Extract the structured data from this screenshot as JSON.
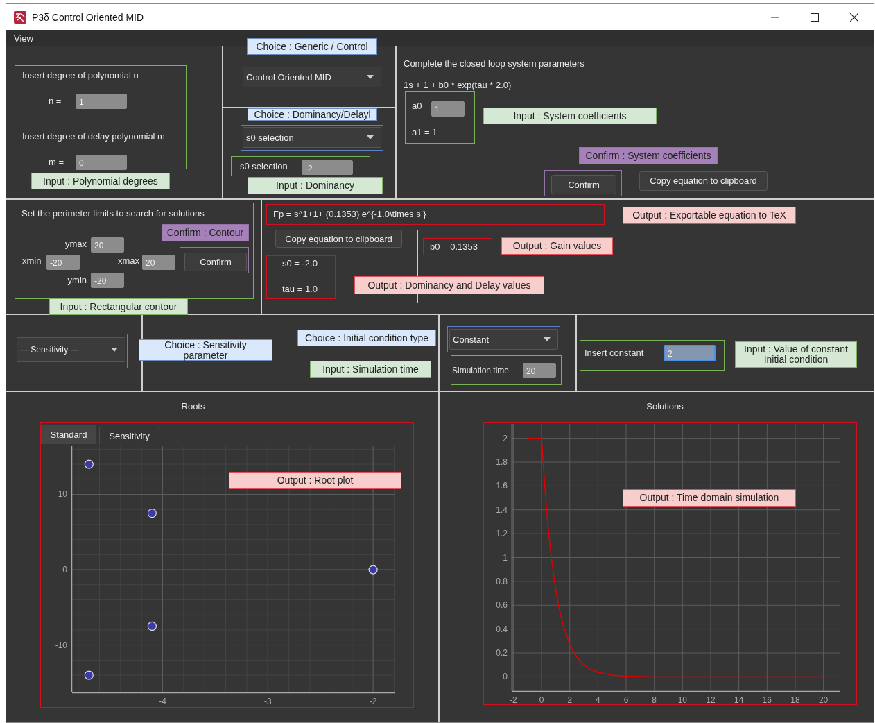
{
  "window": {
    "title": "P3δ Control Oriented MID"
  },
  "menu": [
    {
      "label": "View"
    }
  ],
  "polynomial_degrees": {
    "n_prompt": "Insert degree of polynomial n",
    "n_label": "n =",
    "n_field": {
      "value": "1",
      "focused": false
    },
    "m_prompt": "Insert degree of delay polynomial m",
    "m_label": "m =",
    "m_field": {
      "value": "0",
      "focused": false
    },
    "notes": [
      {
        "kind": "input",
        "text": "Input : Polynomial degrees"
      }
    ]
  },
  "mode": {
    "notes": [
      {
        "kind": "choice",
        "text": "Choice : Generic / Control"
      }
    ],
    "dropdown": "Control Oriented MID"
  },
  "dominancy": {
    "notes": [
      {
        "kind": "choice",
        "text": "Choice : Dominancy/Delayl"
      },
      {
        "kind": "input",
        "text": "Input : Dominancy"
      }
    ],
    "dropdown": "s0 selection",
    "s0_label": "s0 selection",
    "s0_field": {
      "value": "-2",
      "focused": false
    }
  },
  "system": {
    "heading": "Complete the closed loop system parameters",
    "equation": "1s + 1 + b0 * exp(tau * 2.0)",
    "a0_label": "a0",
    "a0_field": {
      "value": "1",
      "focused": false
    },
    "a1": "a1 = 1",
    "notes": [
      {
        "kind": "input",
        "text": "Input : System coefficients"
      },
      {
        "kind": "confirm",
        "text": "Confirm : System coefficients"
      }
    ],
    "confirm_button": "Confirm",
    "copy_button": "Copy equation to clipboard"
  },
  "contour": {
    "heading": "Set the perimeter limits to search for solutions",
    "fields": [
      {
        "label": "ymax",
        "value": "20",
        "focused": false
      },
      {
        "label": "xmin",
        "value": "-20",
        "focused": false
      },
      {
        "label": "xmax",
        "value": "20",
        "focused": false
      },
      {
        "label": "ymin",
        "value": "-20",
        "focused": false
      }
    ],
    "confirm_button": "Confirm",
    "notes": [
      {
        "kind": "confirm",
        "text": "Confirm : Contour"
      },
      {
        "kind": "input",
        "text": "Input : Rectangular contour"
      }
    ]
  },
  "output": {
    "equation": "Fp = s^1+1+ (0.1353) e^{-1.0\\times s }",
    "copy_button": "Copy equation to clipboard",
    "s0": "s0 = -2.0",
    "tau": "tau = 1.0",
    "b0": "b0 = 0.1353",
    "notes": [
      {
        "kind": "output",
        "text": "Output : Exportable equation to TeX"
      },
      {
        "kind": "output",
        "text": "Output : Gain values"
      },
      {
        "kind": "output",
        "text": "Output : Dominancy and Delay values"
      }
    ]
  },
  "simulation": {
    "sensitivity_dropdown": "--- Sensitivity ---",
    "initial_condition_dropdown": "Constant",
    "time_label": "Simulation time",
    "time_field": {
      "value": "20",
      "focused": false
    },
    "constant_label": "Insert constant",
    "constant_field": {
      "value": "2",
      "focused": true
    },
    "notes": [
      {
        "kind": "choice",
        "text": "Choice : Sensitivity parameter"
      },
      {
        "kind": "choice",
        "text": "Choice : Initial condition type"
      },
      {
        "kind": "input",
        "text": "Input : Simulation time"
      },
      {
        "kind": "input",
        "text": "Input : Value of constant Initial condition"
      }
    ]
  },
  "roots": {
    "title": "Roots",
    "tabs": [
      {
        "label": "Standard",
        "selected": true
      },
      {
        "label": "Sensitivity",
        "selected": false
      }
    ],
    "notes": [
      {
        "kind": "output",
        "text": "Output : Root plot"
      }
    ],
    "chart_data": {
      "type": "scatter",
      "grid": true,
      "xlim": [
        -4.86,
        -1.79
      ],
      "ylim": [
        -16.3,
        16.4
      ],
      "xticks": [
        -4,
        -3,
        -2
      ],
      "yticks": [
        -10,
        0,
        10
      ],
      "x": [
        -4.7,
        -4.1,
        -2,
        -4.1,
        -4.7
      ],
      "series": [
        {
          "color": "#3a3aa8",
          "values": [
            14,
            7.5,
            0,
            -7.5,
            -14
          ]
        }
      ]
    }
  },
  "solutions": {
    "title": "Solutions",
    "notes": [
      {
        "kind": "output",
        "text": "Output : Time domain simulation"
      }
    ],
    "chart_data": {
      "type": "line",
      "grid": true,
      "xlim": [
        -2.07,
        21.2
      ],
      "ylim": [
        -0.12,
        2.12
      ],
      "xticks": [
        -2,
        0,
        2,
        4,
        6,
        8,
        10,
        12,
        14,
        16,
        18,
        20
      ],
      "yticks": [
        0,
        0.2,
        0.4,
        0.6,
        0.8,
        1,
        1.2,
        1.4,
        1.6,
        1.8,
        2
      ],
      "x": [
        -1,
        0,
        0.25,
        0.5,
        0.75,
        1,
        1.25,
        1.5,
        2,
        2.5,
        3,
        3.5,
        4,
        5,
        6,
        8,
        10,
        12,
        14,
        16,
        18,
        20
      ],
      "series": [
        {
          "color": "#e00000",
          "values": [
            2,
            2,
            1.558,
            1.213,
            0.945,
            0.736,
            0.573,
            0.446,
            0.271,
            0.164,
            0.1,
            0.06,
            0.037,
            0.013,
            0.005,
            0,
            0,
            0,
            0,
            0,
            0,
            0
          ]
        }
      ]
    }
  }
}
